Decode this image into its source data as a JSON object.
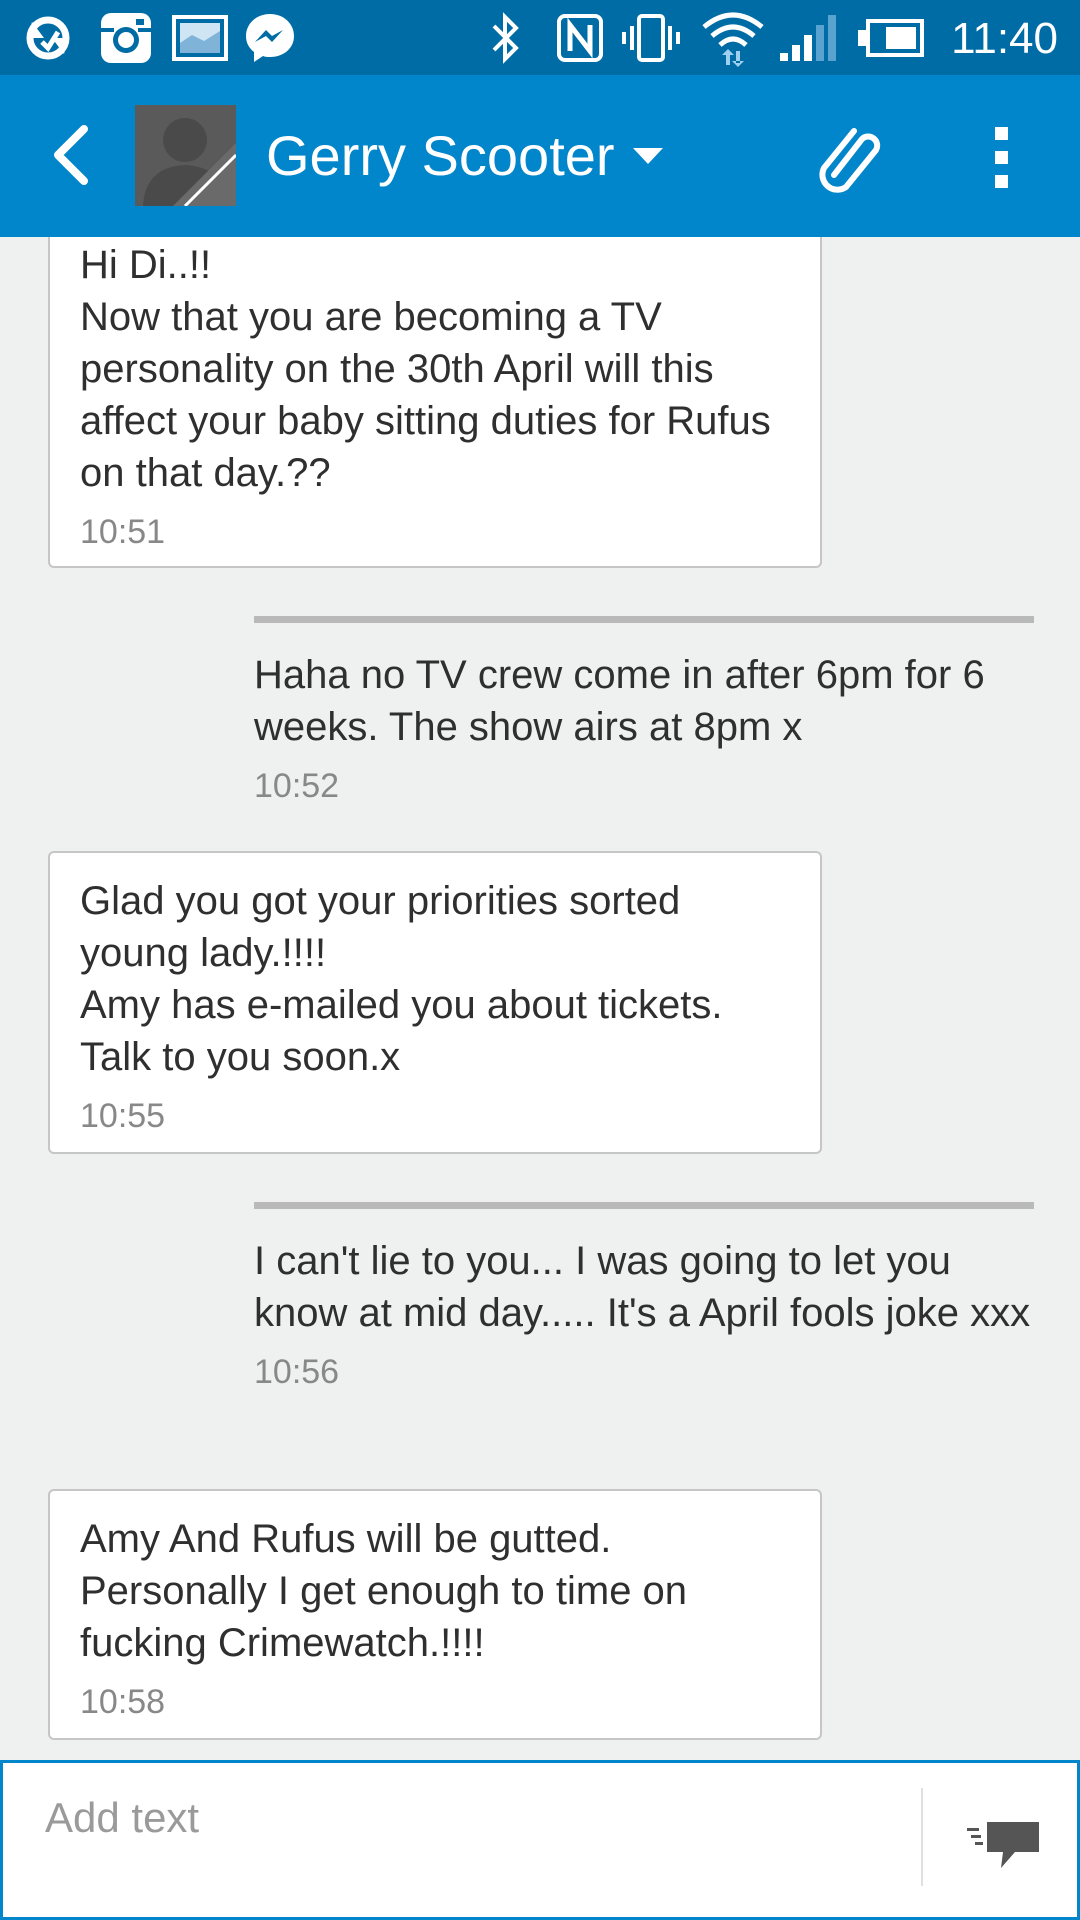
{
  "status_bar": {
    "time": "11:40",
    "left_icons": [
      "sync-icon",
      "instagram-icon",
      "gallery-icon",
      "messenger-icon"
    ],
    "right_icons": [
      "bluetooth-icon",
      "nfc-icon",
      "vibrate-icon",
      "wifi-icon",
      "cell-signal-icon",
      "battery-icon"
    ]
  },
  "header": {
    "contact_name": "Gerry Scooter"
  },
  "conversation": {
    "messages": [
      {
        "direction": "incoming",
        "text": "Hi Di..!!\nNow that you are becoming a TV personality on the 30th April will this affect your baby sitting duties for Rufus on that day.??",
        "time": "10:51"
      },
      {
        "direction": "outgoing",
        "text": "Haha no TV crew come in after 6pm for 6 weeks. The show airs at 8pm x",
        "time": "10:52"
      },
      {
        "direction": "incoming",
        "text": "Glad you got your priorities sorted young lady.!!!!\nAmy has e-mailed you about tickets. Talk to you soon.x",
        "time": "10:55"
      },
      {
        "direction": "outgoing",
        "text": "I can't lie to you... I was going to let you know at mid day..... It's a April fools joke xxx",
        "time": "10:56"
      },
      {
        "direction": "incoming",
        "text": "Amy And Rufus will be gutted. Personally I get enough to time on fucking Crimewatch.!!!!",
        "time": "10:58"
      }
    ]
  },
  "composer": {
    "placeholder": "Add text"
  },
  "colors": {
    "status_bar": "#006ca6",
    "app_bar": "#0185cb",
    "background": "#eff0f0",
    "bubble": "#ffffff"
  }
}
